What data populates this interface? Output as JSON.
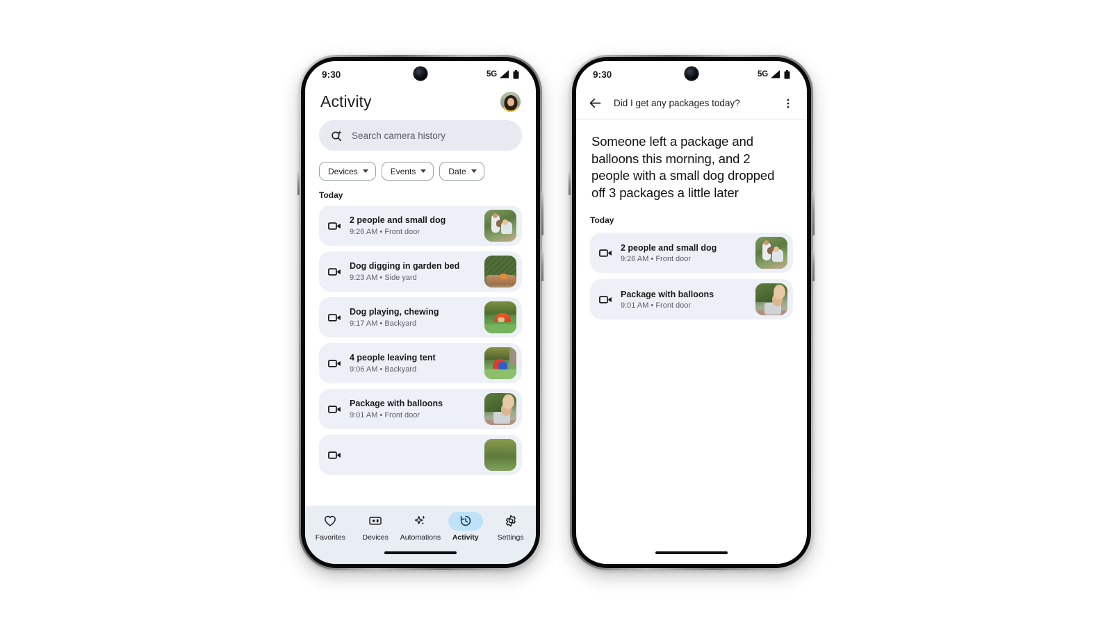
{
  "phones": {
    "left": {
      "status": {
        "time": "9:30",
        "network": "5G",
        "signal_icon": "signal-bars-icon",
        "battery_icon": "battery-full-icon"
      },
      "header": {
        "title": "Activity",
        "avatar_name": "user-avatar"
      },
      "search": {
        "placeholder": "Search camera history",
        "icon": "ai-search-icon"
      },
      "filters": [
        {
          "label": "Devices"
        },
        {
          "label": "Events"
        },
        {
          "label": "Date"
        }
      ],
      "section_label": "Today",
      "events": [
        {
          "title": "2 people and small dog",
          "meta": "9:26 AM • Front door",
          "icon": "video-camera-icon",
          "scene": "people"
        },
        {
          "title": "Dog digging in garden bed",
          "meta": "9:23 AM • Side yard",
          "icon": "video-camera-icon",
          "scene": "garden"
        },
        {
          "title": "Dog playing, chewing",
          "meta": "9:17 AM • Backyard",
          "icon": "video-camera-icon",
          "scene": "play"
        },
        {
          "title": "4 people leaving tent",
          "meta": "9:06 AM • Backyard",
          "icon": "video-camera-icon",
          "scene": "tent"
        },
        {
          "title": "Package with balloons",
          "meta": "9:01 AM • Front door",
          "icon": "video-camera-icon",
          "scene": "pkg"
        }
      ],
      "nav": [
        {
          "label": "Favorites",
          "icon": "heart-icon",
          "active": false
        },
        {
          "label": "Devices",
          "icon": "devices-icon",
          "active": false
        },
        {
          "label": "Automations",
          "icon": "sparkles-icon",
          "active": false
        },
        {
          "label": "Activity",
          "icon": "history-icon",
          "active": true
        },
        {
          "label": "Settings",
          "icon": "gear-icon",
          "active": false
        }
      ]
    },
    "right": {
      "status": {
        "time": "9:30",
        "network": "5G",
        "signal_icon": "signal-bars-icon",
        "battery_icon": "battery-full-icon"
      },
      "topbar": {
        "title": "Did I get any packages today?",
        "back_icon": "arrow-back-icon",
        "overflow_icon": "more-vertical-icon"
      },
      "summary": "Someone left a package and balloons this morning, and 2 people with a small dog dropped off 3 packages a little later",
      "section_label": "Today",
      "results": [
        {
          "title": "2 people and small dog",
          "meta": "9:26 AM • Front door",
          "icon": "video-camera-icon",
          "scene": "people"
        },
        {
          "title": "Package with balloons",
          "meta": "9:01 AM • Front door",
          "icon": "video-camera-icon",
          "scene": "pkg"
        }
      ]
    }
  },
  "colors": {
    "accent_pill": "#bfe2fb",
    "surface_row": "#edf0f7",
    "search_bg": "#e8eaf1",
    "nav_bg": "#e9eef5",
    "text_primary": "#1c1b1f",
    "text_secondary": "#5c5f66",
    "page_bg": "#ffffff"
  }
}
